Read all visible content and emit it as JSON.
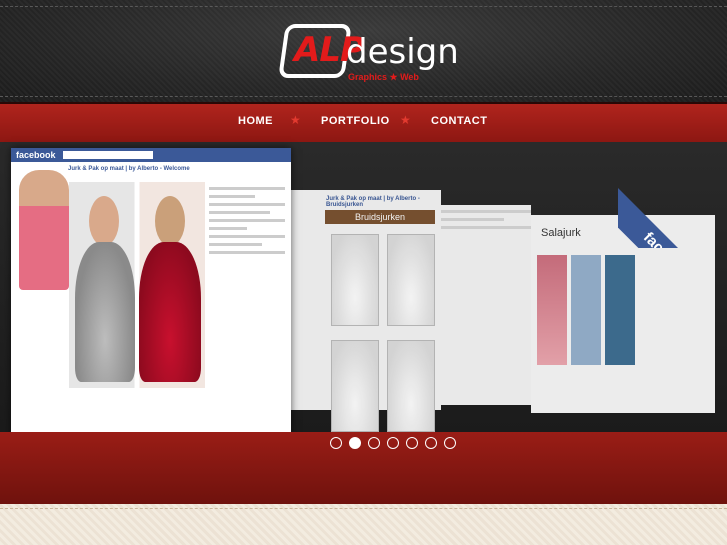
{
  "brand": {
    "logo_primary": "ALP",
    "logo_secondary": "design",
    "logo_tagline": "Graphics ★ Web"
  },
  "nav": {
    "items": [
      {
        "label": "HOME"
      },
      {
        "label": "PORTFOLIO"
      },
      {
        "label": "CONTACT"
      }
    ]
  },
  "slider": {
    "slides": [
      {
        "fb_brand": "facebook",
        "title": "Jurk & Pak op maat | by Alberto - Welcome"
      },
      {
        "title": "Jurk & Pak op maat | by Alberto - Bruidsjurken",
        "banner": "Bruidsjurken"
      },
      {
        "title": "Salajurk"
      }
    ],
    "ribbon_text": "facebook",
    "dots_count": 7,
    "active_dot": 1
  },
  "colors": {
    "accent_red": "#b0241d",
    "facebook_blue": "#3b5998"
  }
}
